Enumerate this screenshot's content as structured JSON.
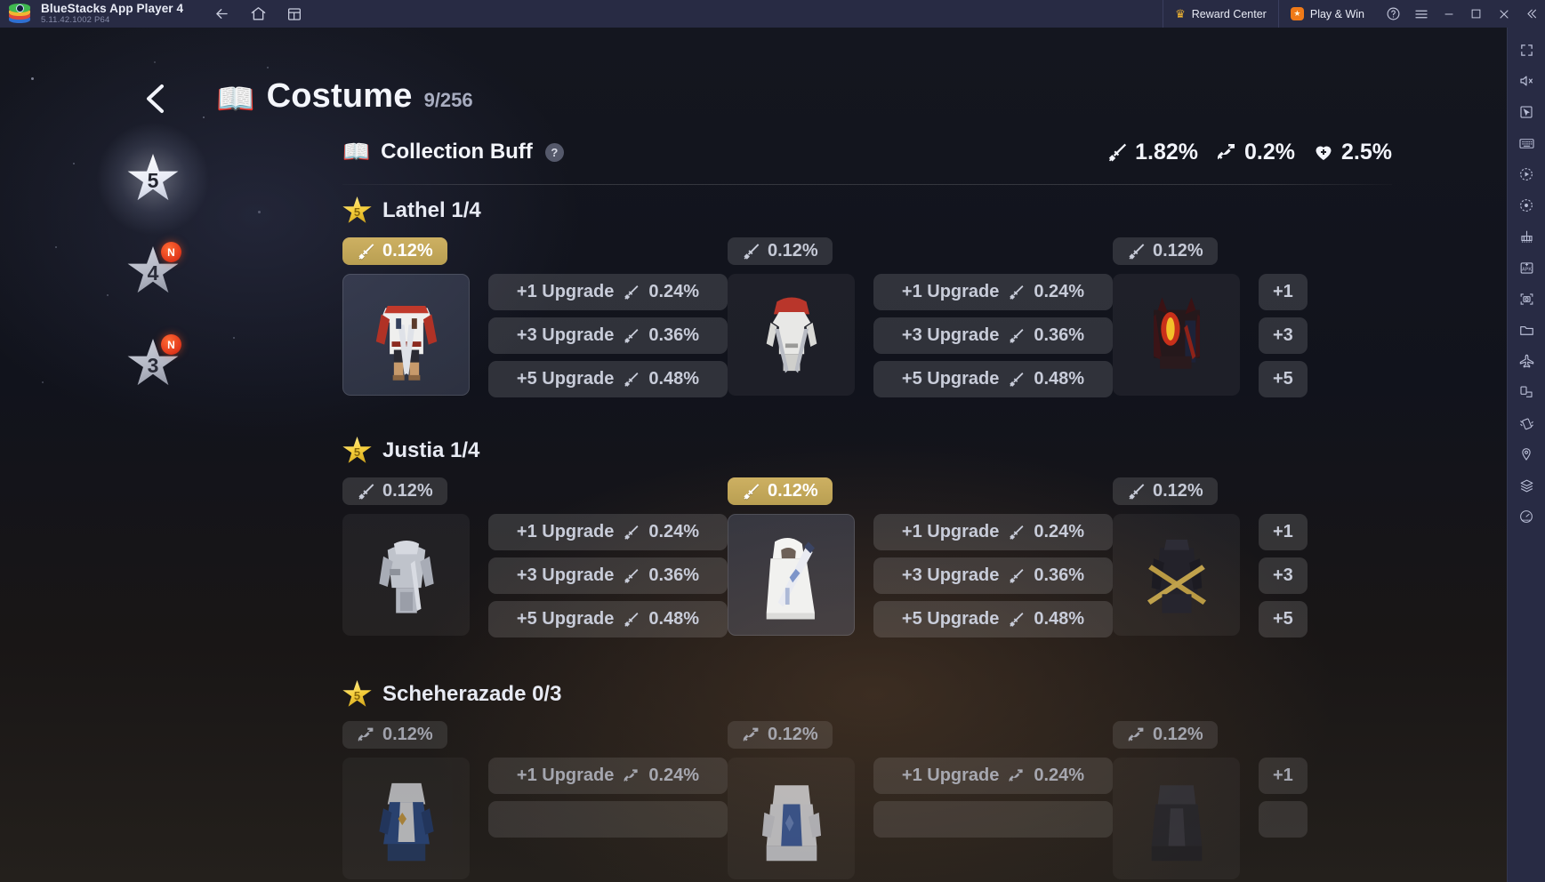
{
  "titlebar": {
    "app_name": "BlueStacks App Player 4",
    "version": "5.11.42.1002  P64",
    "nav": [
      {
        "name": "back-icon",
        "label": "Back"
      },
      {
        "name": "home-icon",
        "label": "Home"
      },
      {
        "name": "multi-instance-icon",
        "label": "Multi-instance"
      }
    ],
    "reward_center": "Reward Center",
    "play_and_win": "Play & Win",
    "help_label": "Help",
    "menu_label": "Menu",
    "minimize_label": "Minimize",
    "maximize_label": "Maximize",
    "close_label": "Close",
    "collapse_label": "Collapse"
  },
  "right_toolbar": {
    "items": [
      "fullscreen-icon",
      "mute-icon",
      "cursor-icon",
      "keyboard-icon",
      "macro-record-icon",
      "record-screen-icon",
      "game-controls-icon",
      "install-apk-icon",
      "screenshot-icon",
      "media-manager-icon",
      "airplane-icon",
      "rotate-screen-icon",
      "shake-icon",
      "location-icon",
      "layers-icon",
      "performance-icon"
    ]
  },
  "header": {
    "back_label": "Back",
    "book_icon": "📖",
    "title": "Costume",
    "count": "9/256"
  },
  "collection_buff": {
    "icon": "sparkle-book-icon",
    "title": "Collection Buff",
    "help": "?",
    "stats": [
      {
        "icon": "sword-icon",
        "value": "1.82%"
      },
      {
        "icon": "bow-icon",
        "value": "0.2%"
      },
      {
        "icon": "heart-icon",
        "value": "2.5%"
      }
    ]
  },
  "rank_rail": [
    {
      "rank": "5",
      "selected": true,
      "new_badge": ""
    },
    {
      "rank": "4",
      "selected": false,
      "new_badge": "N"
    },
    {
      "rank": "3",
      "selected": false,
      "new_badge": "N"
    }
  ],
  "groups": [
    {
      "star": "5",
      "name": "Lathel 1/4",
      "faded": false,
      "cards": [
        {
          "badge": {
            "icon": "sword-icon",
            "value": "0.12%",
            "active": true
          },
          "thumb": "lathel-white-dualblade-costume",
          "thumb_state": "selected",
          "upgrades": [
            {
              "label": "+1 Upgrade",
              "icon": "sword-icon",
              "value": "0.24%",
              "short": "+1"
            },
            {
              "label": "+3 Upgrade",
              "icon": "sword-icon",
              "value": "0.36%",
              "short": "+3"
            },
            {
              "label": "+5 Upgrade",
              "icon": "sword-icon",
              "value": "0.48%",
              "short": "+5"
            }
          ]
        },
        {
          "badge": {
            "icon": "sword-icon",
            "value": "0.12%",
            "active": false
          },
          "thumb": "lathel-red-hood-costume",
          "thumb_state": "dim",
          "upgrades": [
            {
              "label": "+1 Upgrade",
              "icon": "sword-icon",
              "value": "0.24%",
              "short": "+1"
            },
            {
              "label": "+3 Upgrade",
              "icon": "sword-icon",
              "value": "0.36%",
              "short": "+3"
            },
            {
              "label": "+5 Upgrade",
              "icon": "sword-icon",
              "value": "0.48%",
              "short": "+5"
            }
          ]
        },
        {
          "badge": {
            "icon": "sword-icon",
            "value": "0.12%",
            "active": false
          },
          "thumb": "lathel-dark-demon-costume",
          "thumb_state": "dim",
          "upgrades": [
            {
              "label": "+1 Upgrade",
              "icon": "sword-icon",
              "value": "0.24%",
              "short": "+1"
            },
            {
              "label": "+3 Upgrade",
              "icon": "sword-icon",
              "value": "0.36%",
              "short": "+3"
            },
            {
              "label": "+5 Upgrade",
              "icon": "sword-icon",
              "value": "0.48%",
              "short": "+5"
            }
          ]
        }
      ]
    },
    {
      "star": "5",
      "name": "Justia 1/4",
      "faded": false,
      "cards": [
        {
          "badge": {
            "icon": "sword-icon",
            "value": "0.12%",
            "active": false
          },
          "thumb": "justia-grey-armor-costume",
          "thumb_state": "dim",
          "upgrades": [
            {
              "label": "+1 Upgrade",
              "icon": "sword-icon",
              "value": "0.24%",
              "short": "+1"
            },
            {
              "label": "+3 Upgrade",
              "icon": "sword-icon",
              "value": "0.36%",
              "short": "+3"
            },
            {
              "label": "+5 Upgrade",
              "icon": "sword-icon",
              "value": "0.48%",
              "short": "+5"
            }
          ]
        },
        {
          "badge": {
            "icon": "sword-icon",
            "value": "0.12%",
            "active": true
          },
          "thumb": "justia-white-robe-costume",
          "thumb_state": "selected",
          "upgrades": [
            {
              "label": "+1 Upgrade",
              "icon": "sword-icon",
              "value": "0.24%",
              "short": "+1"
            },
            {
              "label": "+3 Upgrade",
              "icon": "sword-icon",
              "value": "0.36%",
              "short": "+3"
            },
            {
              "label": "+5 Upgrade",
              "icon": "sword-icon",
              "value": "0.48%",
              "short": "+5"
            }
          ]
        },
        {
          "badge": {
            "icon": "sword-icon",
            "value": "0.12%",
            "active": false
          },
          "thumb": "justia-black-gold-costume",
          "thumb_state": "dim",
          "upgrades": [
            {
              "label": "+1 Upgrade",
              "icon": "sword-icon",
              "value": "0.24%",
              "short": "+1"
            },
            {
              "label": "+3 Upgrade",
              "icon": "sword-icon",
              "value": "0.36%",
              "short": "+3"
            },
            {
              "label": "+5 Upgrade",
              "icon": "sword-icon",
              "value": "0.48%",
              "short": "+5"
            }
          ]
        }
      ]
    },
    {
      "star": "5",
      "name": "Scheherazade 0/3",
      "faded": true,
      "cards": [
        {
          "badge": {
            "icon": "bow-icon",
            "value": "0.12%",
            "active": false
          },
          "thumb": "scheherazade-blue-costume",
          "thumb_state": "dim",
          "upgrades": [
            {
              "label": "+1 Upgrade",
              "icon": "bow-icon",
              "value": "0.24%",
              "short": "+1"
            }
          ]
        },
        {
          "badge": {
            "icon": "bow-icon",
            "value": "0.12%",
            "active": false
          },
          "thumb": "scheherazade-white-blue-costume",
          "thumb_state": "dim",
          "upgrades": [
            {
              "label": "+1 Upgrade",
              "icon": "bow-icon",
              "value": "0.24%",
              "short": "+1"
            }
          ]
        },
        {
          "badge": {
            "icon": "bow-icon",
            "value": "0.12%",
            "active": false
          },
          "thumb": "scheherazade-dark-costume",
          "thumb_state": "dim",
          "upgrades": [
            {
              "label": "+1 Upgrade",
              "icon": "bow-icon",
              "value": "0.24%",
              "short": "+1"
            }
          ]
        }
      ]
    }
  ],
  "colors": {
    "gold_badge": "#c0a659",
    "panel": "#14161f",
    "titlebar": "#282b44",
    "new_badge": "#e0361a"
  }
}
